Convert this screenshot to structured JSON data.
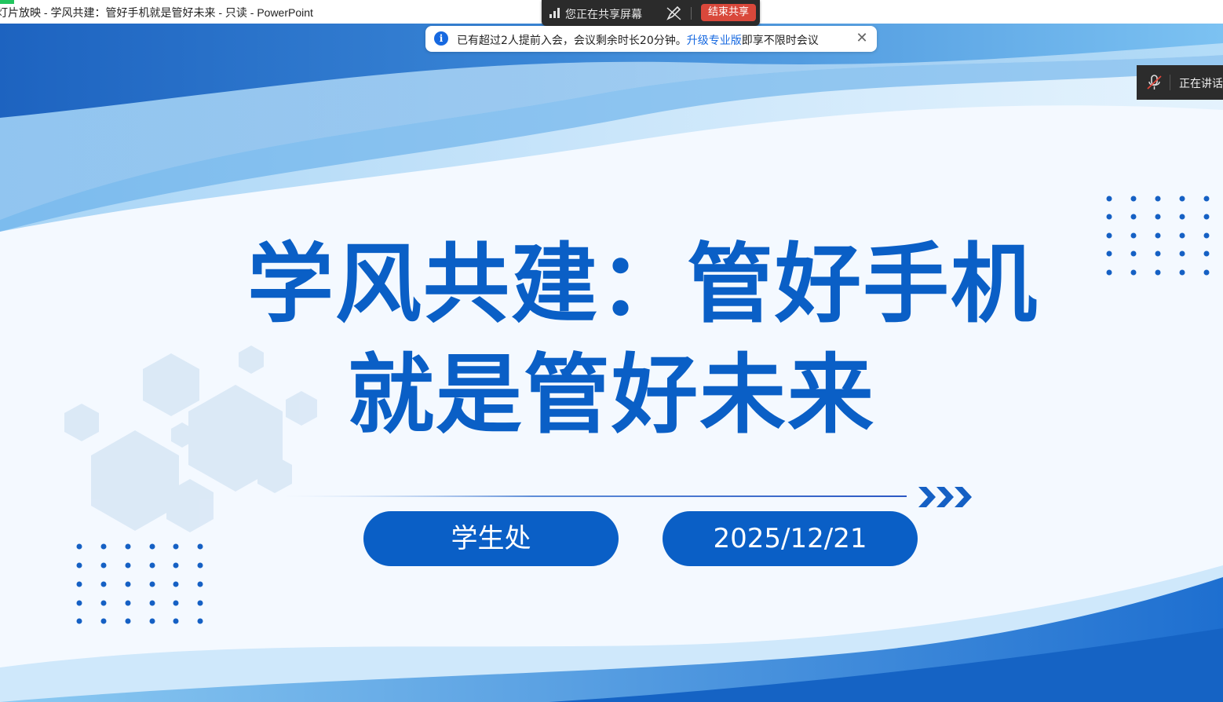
{
  "window": {
    "title": "灯片放映  -  学风共建：管好手机就是管好未来  -  只读 - PowerPoint"
  },
  "share_bar": {
    "sharing_label": "您正在共享屏幕",
    "end_button": "结束共享"
  },
  "notice": {
    "message_prefix": "已有超过2人提前入会，会议剩余时长20分钟。",
    "upgrade_link": "升级专业版",
    "message_suffix": "即享不限时会议"
  },
  "speaking": {
    "label": "正在讲话"
  },
  "slide": {
    "title_line1": "学风共建：管好手机",
    "title_line2": "就是管好未来",
    "department": "学生处",
    "date": "2025/12/21"
  },
  "colors": {
    "primary_blue": "#0a5fc6",
    "end_share_red": "#d9483b",
    "link_blue": "#1769e0"
  }
}
